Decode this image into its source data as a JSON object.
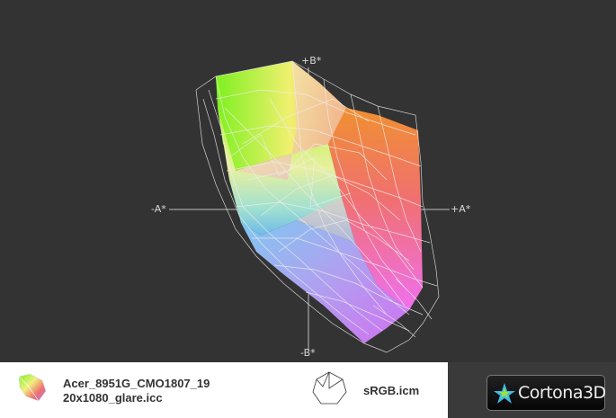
{
  "viewer": {
    "axes": {
      "plus_b": "+B*",
      "minus_b": "-B*",
      "minus_a": "-A*",
      "plus_a": "+A*"
    },
    "background_color": "#333333"
  },
  "legend": {
    "items": [
      {
        "name": "Acer_8951G_CMO1807_1920x1080_glare.icc",
        "line1": "Acer_8951G_CMO1807_19",
        "line2": "20x1080_glare.icc",
        "icon": "color-gamut-icon"
      },
      {
        "name": "sRGB.icm",
        "icon": "wireframe-gamut-icon"
      }
    ]
  },
  "brand": {
    "label": "Cortona3D",
    "icon": "cortona-star-icon"
  }
}
